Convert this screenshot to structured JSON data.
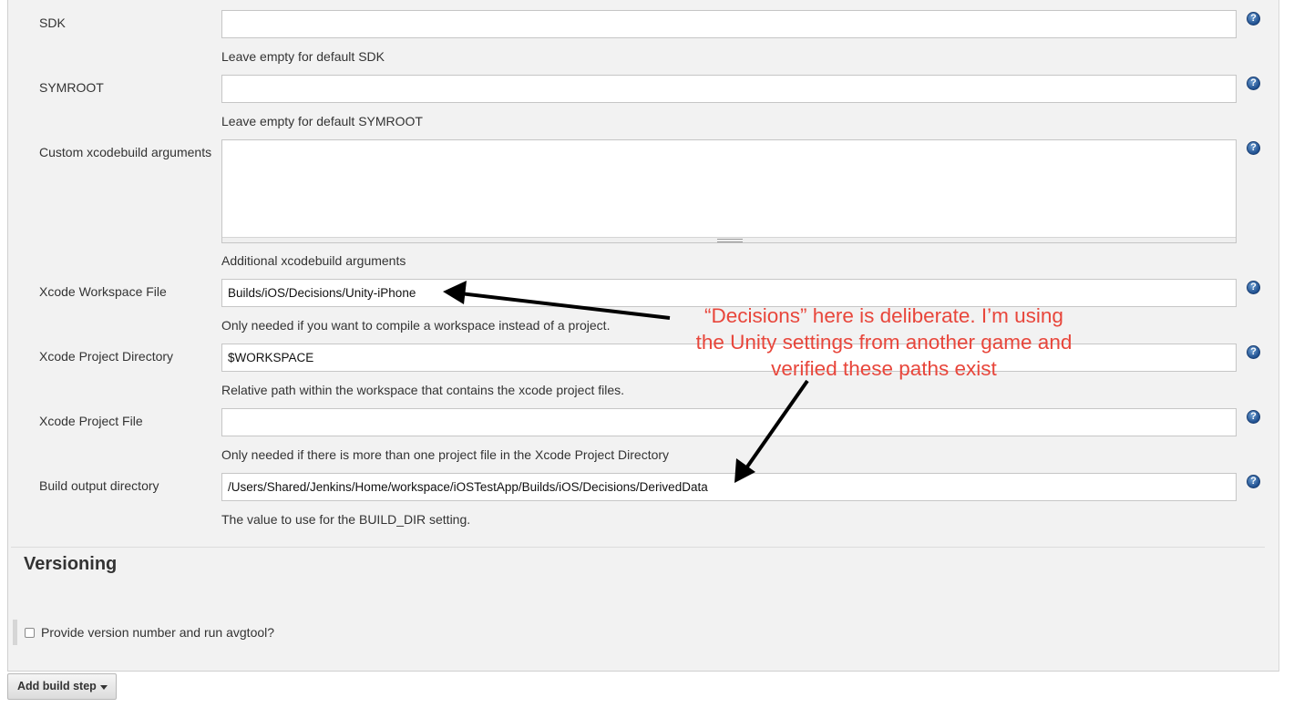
{
  "fields": [
    {
      "label": "SDK",
      "value": "",
      "help": "Leave empty for default SDK"
    },
    {
      "label": "SYMROOT",
      "value": "",
      "help": "Leave empty for default SYMROOT"
    },
    {
      "label": "Custom xcodebuild arguments",
      "value": "",
      "help": "Additional xcodebuild arguments"
    },
    {
      "label": "Xcode Workspace File",
      "value": "Builds/iOS/Decisions/Unity-iPhone",
      "help": "Only needed if you want to compile a workspace instead of a project."
    },
    {
      "label": "Xcode Project Directory",
      "value": "$WORKSPACE",
      "help": "Relative path within the workspace that contains the xcode project files."
    },
    {
      "label": "Xcode Project File",
      "value": "",
      "help": "Only needed if there is more than one project file in the Xcode Project Directory"
    },
    {
      "label": "Build output directory",
      "value": "/Users/Shared/Jenkins/Home/workspace/iOSTestApp/Builds/iOS/Decisions/DerivedData",
      "help": "The value to use for the BUILD_DIR setting."
    }
  ],
  "help_icon_glyph": "?",
  "versioning": {
    "title": "Versioning",
    "checkbox_label": "Provide version number and run avgtool?",
    "checked": false
  },
  "add_build_step_label": "Add build step",
  "annotation": {
    "lines": [
      "“Decisions” here is deliberate. I’m using",
      "the Unity settings from another game and",
      "verified these paths exist"
    ],
    "color": "#e8463b"
  },
  "colors": {
    "panel_bg": "#f2f2f2",
    "help_icon": "#2a5b9c"
  }
}
